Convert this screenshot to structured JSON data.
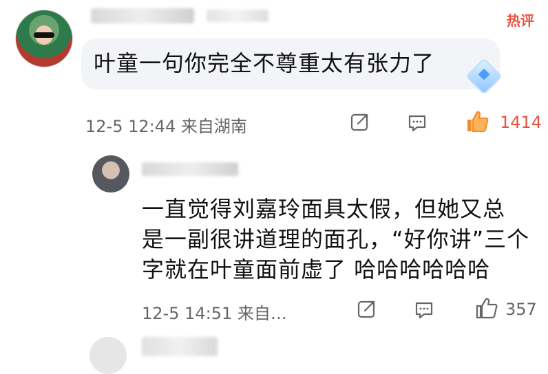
{
  "post": {
    "hot_label": "热评",
    "main_comment": {
      "text": "叶童一句你完全不尊重太有张力了",
      "time_location": "12-5 12:44  来自湖南",
      "like_count": "1414"
    },
    "reply": {
      "text_line1": "一直觉得刘嘉玲面具太假，但她又总",
      "text_line2": "是一副很讲道理的面孔，“好你讲”三个",
      "text_line3": "字就在叶童面前虚了 哈哈哈哈哈哈",
      "time_location": "12-5 14:51  来自…",
      "like_count": "357"
    }
  },
  "colors": {
    "accent_red": "#e8523f",
    "bubble_bg": "#f2f4f8",
    "meta_gray": "#666666"
  },
  "icons": {
    "share": "share-icon",
    "comment": "comment-icon",
    "like": "thumb-up-icon",
    "badge": "diamond-badge-icon"
  }
}
